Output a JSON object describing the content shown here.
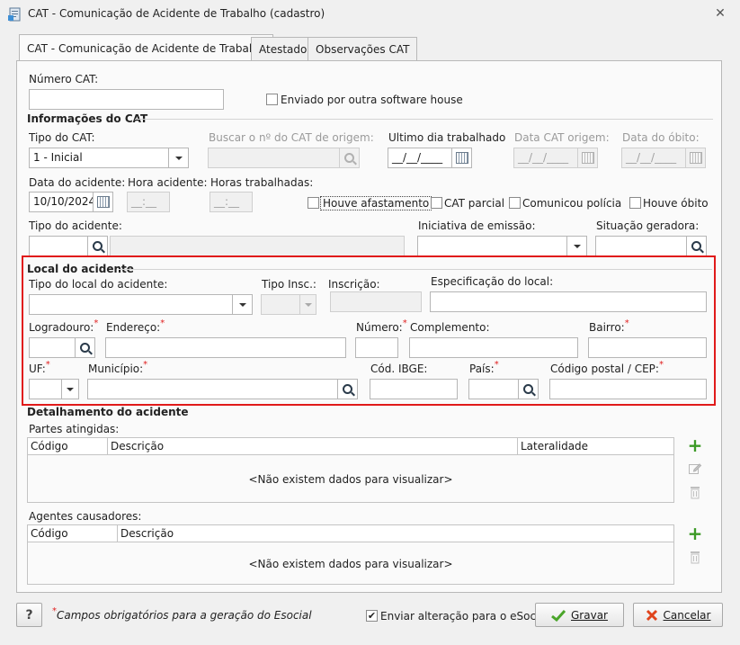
{
  "window": {
    "title": "CAT - Comunicação de Acidente de Trabalho (cadastro)",
    "close": "✕"
  },
  "tabs": [
    "CAT - Comunicação de Acidente de Trabalho",
    "Atestado",
    "Observações CAT"
  ],
  "numero_cat": {
    "label": "Número CAT:",
    "value": ""
  },
  "enviado_outra": {
    "label": "Enviado por outra software house",
    "checked": false
  },
  "info_cat": {
    "section": "Informações do CAT",
    "tipo_label": "Tipo do CAT:",
    "tipo_value": "1 - Inicial",
    "buscar_label": "Buscar o nº do CAT de origem:",
    "ultimo_dia_label": "Ultimo dia trabalhado",
    "ultimo_dia_value": "__/__/____",
    "data_origem_label": "Data CAT origem:",
    "data_origem_value": "__/__/____",
    "data_obito_label": "Data do óbito:",
    "data_obito_value": "__/__/____",
    "data_acidente_label": "Data do acidente:",
    "data_acidente_value": "10/10/2024",
    "hora_acidente_label": "Hora acidente:",
    "hora_acidente_value": "__:__",
    "horas_trab_label": "Horas trabalhadas:",
    "horas_trab_value": "__:__",
    "houve_afastamento": "Houve afastamento",
    "cat_parcial": "CAT parcial",
    "comunicou_policia": "Comunicou polícia",
    "houve_obito": "Houve óbito",
    "tipo_acidente_label": "Tipo do acidente:",
    "iniciativa_label": "Iniciativa de emissão:",
    "situacao_label": "Situação geradora:"
  },
  "local": {
    "section": "Local do acidente",
    "tipo_local_label": "Tipo do local do acidente:",
    "tipo_insc_label": "Tipo Insc.:",
    "inscricao_label": "Inscrição:",
    "especificacao_label": "Especificação do local:",
    "logradouro_label": "Logradouro:",
    "endereco_label": "Endereço:",
    "numero_label": "Número:",
    "complemento_label": "Complemento:",
    "bairro_label": "Bairro:",
    "uf_label": "UF:",
    "municipio_label": "Município:",
    "ibge_label": "Cód. IBGE:",
    "pais_label": "País:",
    "cep_label": "Código postal / CEP:",
    "req": "*"
  },
  "detalhamento": {
    "section": "Detalhamento do acidente",
    "partes_label": "Partes atingidas:",
    "partes_cols": [
      "Código",
      "Descrição",
      "Lateralidade"
    ],
    "agentes_label": "Agentes causadores:",
    "agentes_cols": [
      "Código",
      "Descrição"
    ],
    "empty": "<Não existem dados para visualizar>"
  },
  "footer": {
    "help": "?",
    "required_note": "Campos obrigatórios para a geração do Esocial",
    "req": "*",
    "enviar_label": "Enviar alteração para o eSocial",
    "enviar_checked": true,
    "gravar": "Gravar",
    "cancelar": "Cancelar"
  },
  "colors": {
    "accent_red": "#e01a1a",
    "add_green": "#3c9a26"
  }
}
